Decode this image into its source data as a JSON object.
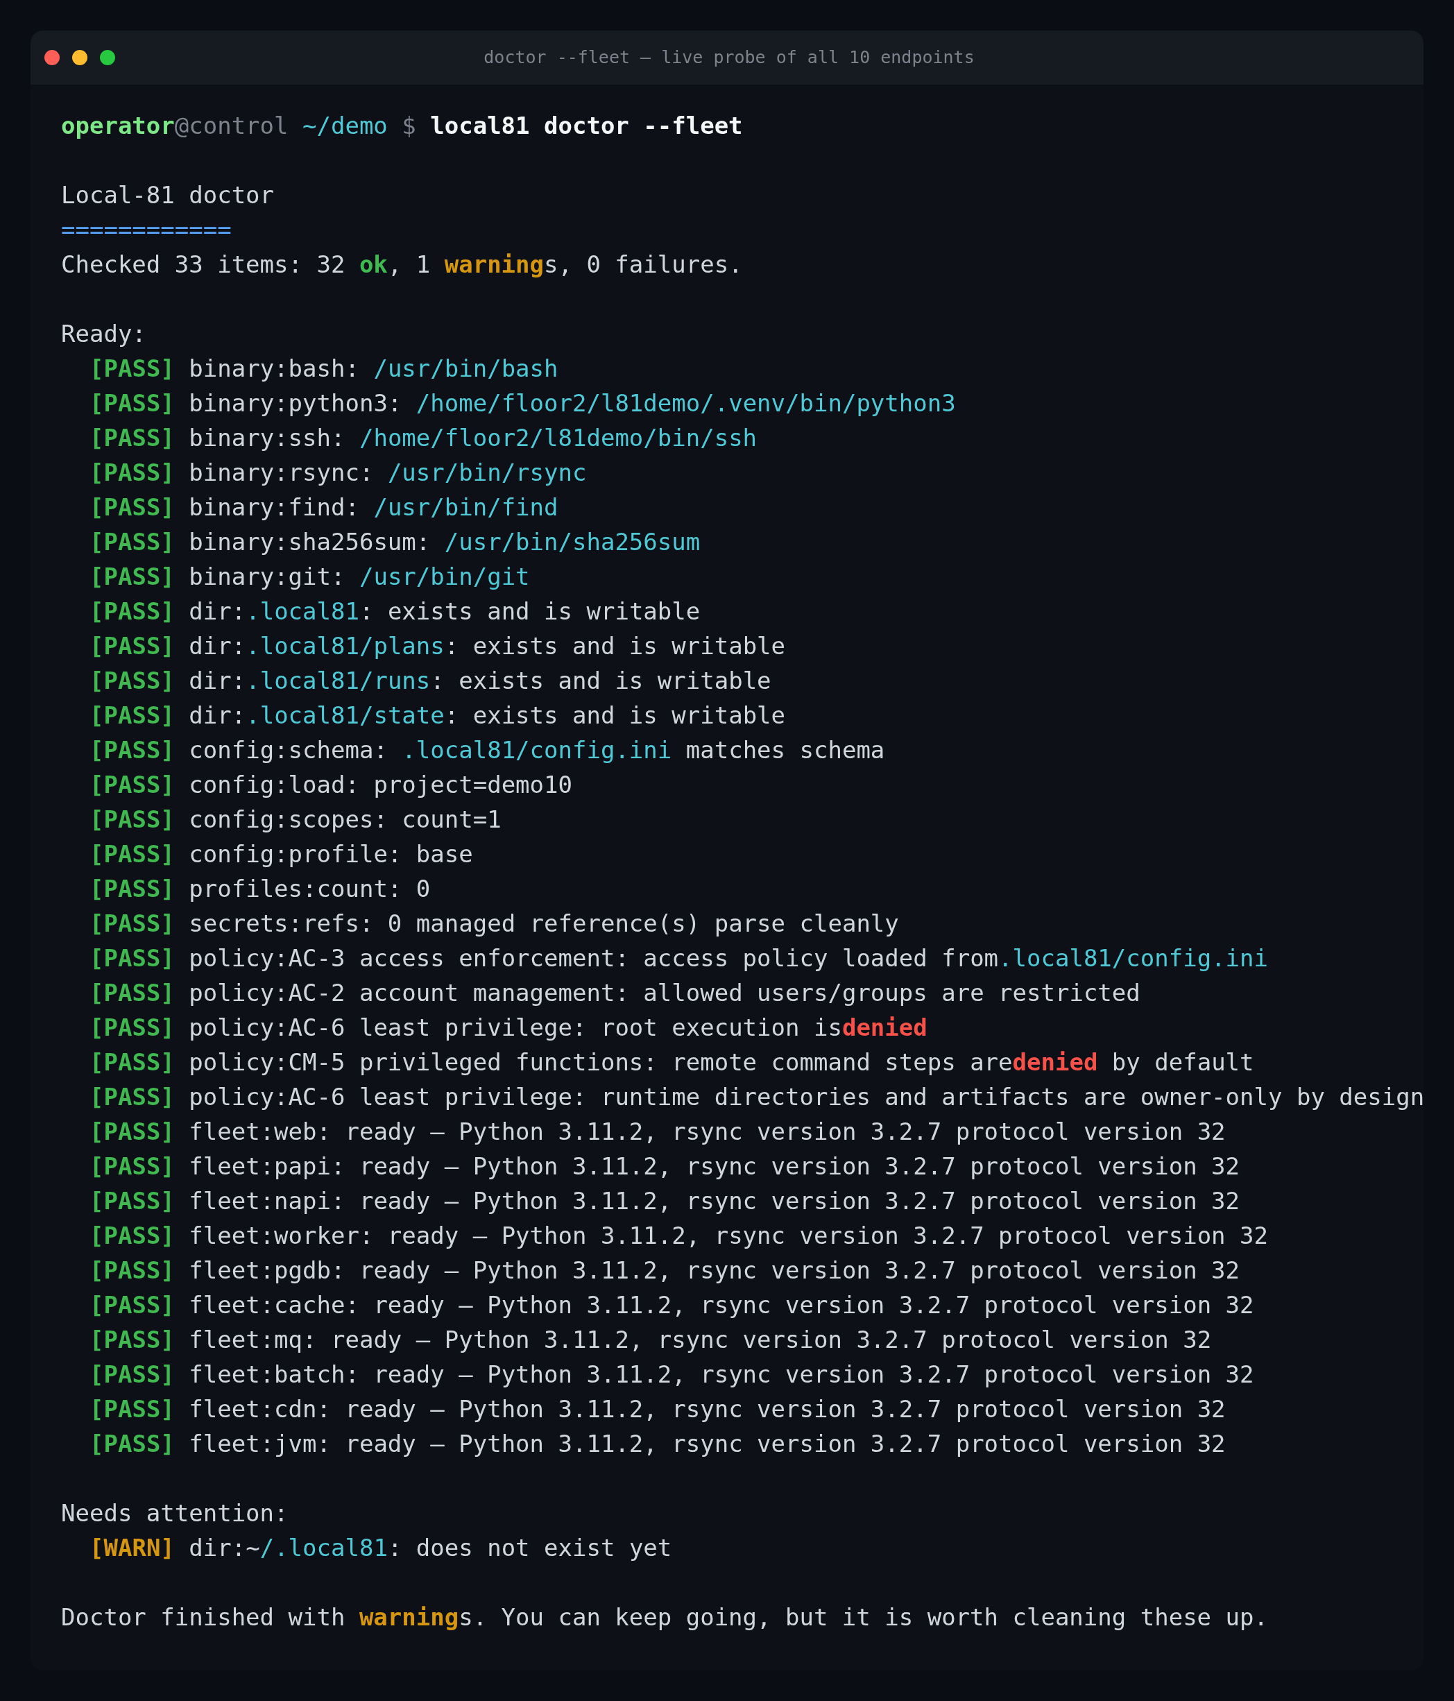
{
  "window": {
    "title": "doctor --fleet — live probe of all 10 endpoints"
  },
  "blocks": [
    {
      "lines": [
        {
          "kind": "prompt",
          "segments": [
            {
              "t": "operator",
              "kind": "user"
            },
            {
              "t": "@control ",
              "kind": "dim"
            },
            {
              "t": "~/demo ",
              "kind": "cwd"
            },
            {
              "t": "$ ",
              "kind": "dim"
            },
            {
              "t": "local81 doctor --fleet",
              "kind": "cmd"
            }
          ]
        }
      ]
    },
    {
      "lines": [
        {
          "kind": "heading",
          "segments": [
            {
              "t": "Local-81 doctor"
            }
          ]
        },
        {
          "kind": "rule",
          "segments": [
            {
              "t": "============",
              "kind": "rule"
            }
          ]
        },
        {
          "kind": "summary",
          "segments": [
            {
              "t": "Checked 33 items: 32 "
            },
            {
              "t": "ok",
              "kind": "ok"
            },
            {
              "t": ", 1 "
            },
            {
              "t": "warning",
              "kind": "warn"
            },
            {
              "t": "s, 0 failures."
            }
          ]
        }
      ]
    },
    {
      "lines": [
        {
          "kind": "label",
          "segments": [
            {
              "t": "Ready:"
            }
          ]
        },
        {
          "kind": "check",
          "segments": [
            {
              "t": "[PASS]",
              "kind": "ok"
            },
            {
              "t": " binary:bash: "
            },
            {
              "t": "/usr/bin/bash",
              "kind": "path"
            }
          ]
        },
        {
          "kind": "check",
          "segments": [
            {
              "t": "[PASS]",
              "kind": "ok"
            },
            {
              "t": " binary:python3: "
            },
            {
              "t": "/home/floor2/l81demo/.venv/bin/python3",
              "kind": "path"
            }
          ]
        },
        {
          "kind": "check",
          "segments": [
            {
              "t": "[PASS]",
              "kind": "ok"
            },
            {
              "t": " binary:ssh: "
            },
            {
              "t": "/home/floor2/l81demo/bin/ssh",
              "kind": "path"
            }
          ]
        },
        {
          "kind": "check",
          "segments": [
            {
              "t": "[PASS]",
              "kind": "ok"
            },
            {
              "t": " binary:rsync: "
            },
            {
              "t": "/usr/bin/rsync",
              "kind": "path"
            }
          ]
        },
        {
          "kind": "check",
          "segments": [
            {
              "t": "[PASS]",
              "kind": "ok"
            },
            {
              "t": " binary:find: "
            },
            {
              "t": "/usr/bin/find",
              "kind": "path"
            }
          ]
        },
        {
          "kind": "check",
          "segments": [
            {
              "t": "[PASS]",
              "kind": "ok"
            },
            {
              "t": " binary:sha256sum: "
            },
            {
              "t": "/usr/bin/sha256sum",
              "kind": "path"
            }
          ]
        },
        {
          "kind": "check",
          "segments": [
            {
              "t": "[PASS]",
              "kind": "ok"
            },
            {
              "t": " binary:git: "
            },
            {
              "t": "/usr/bin/git",
              "kind": "path"
            }
          ]
        },
        {
          "kind": "check",
          "segments": [
            {
              "t": "[PASS]",
              "kind": "ok"
            },
            {
              "t": " dir:"
            },
            {
              "t": ".local81",
              "kind": "path"
            },
            {
              "t": ": exists and is writable"
            }
          ]
        },
        {
          "kind": "check",
          "segments": [
            {
              "t": "[PASS]",
              "kind": "ok"
            },
            {
              "t": " dir:"
            },
            {
              "t": ".local81/plans",
              "kind": "path"
            },
            {
              "t": ": exists and is writable"
            }
          ]
        },
        {
          "kind": "check",
          "segments": [
            {
              "t": "[PASS]",
              "kind": "ok"
            },
            {
              "t": " dir:"
            },
            {
              "t": ".local81/runs",
              "kind": "path"
            },
            {
              "t": ": exists and is writable"
            }
          ]
        },
        {
          "kind": "check",
          "segments": [
            {
              "t": "[PASS]",
              "kind": "ok"
            },
            {
              "t": " dir:"
            },
            {
              "t": ".local81/state",
              "kind": "path"
            },
            {
              "t": ": exists and is writable"
            }
          ]
        },
        {
          "kind": "check",
          "segments": [
            {
              "t": "[PASS]",
              "kind": "ok"
            },
            {
              "t": " config:schema: "
            },
            {
              "t": ".local81/config.ini",
              "kind": "path"
            },
            {
              "t": " matches schema"
            }
          ]
        },
        {
          "kind": "check",
          "segments": [
            {
              "t": "[PASS]",
              "kind": "ok"
            },
            {
              "t": " config:load: project=demo10"
            }
          ]
        },
        {
          "kind": "check",
          "segments": [
            {
              "t": "[PASS]",
              "kind": "ok"
            },
            {
              "t": " config:scopes: count=1"
            }
          ]
        },
        {
          "kind": "check",
          "segments": [
            {
              "t": "[PASS]",
              "kind": "ok"
            },
            {
              "t": " config:profile: base"
            }
          ]
        },
        {
          "kind": "check",
          "segments": [
            {
              "t": "[PASS]",
              "kind": "ok"
            },
            {
              "t": " profiles:count: 0"
            }
          ]
        },
        {
          "kind": "check",
          "segments": [
            {
              "t": "[PASS]",
              "kind": "ok"
            },
            {
              "t": " secrets:refs: 0 managed reference(s) parse cleanly"
            }
          ]
        },
        {
          "kind": "check",
          "segments": [
            {
              "t": "[PASS]",
              "kind": "ok"
            },
            {
              "t": " policy:AC-3 access enforcement: access policy loaded from"
            },
            {
              "t": ".local81/config.ini",
              "kind": "path"
            }
          ]
        },
        {
          "kind": "check",
          "segments": [
            {
              "t": "[PASS]",
              "kind": "ok"
            },
            {
              "t": " policy:AC-2 account management: allowed users/groups are restricted"
            }
          ]
        },
        {
          "kind": "check",
          "segments": [
            {
              "t": "[PASS]",
              "kind": "ok"
            },
            {
              "t": " policy:AC-6 least privilege: root execution is"
            },
            {
              "t": "denied",
              "kind": "deny"
            }
          ]
        },
        {
          "kind": "check",
          "segments": [
            {
              "t": "[PASS]",
              "kind": "ok"
            },
            {
              "t": " policy:CM-5 privileged functions: remote command steps are"
            },
            {
              "t": "denied",
              "kind": "deny"
            },
            {
              "t": " by default"
            }
          ]
        },
        {
          "kind": "check",
          "segments": [
            {
              "t": "[PASS]",
              "kind": "ok"
            },
            {
              "t": " policy:AC-6 least privilege: runtime directories and artifacts are owner-only by design"
            }
          ]
        },
        {
          "kind": "check",
          "segments": [
            {
              "t": "[PASS]",
              "kind": "ok"
            },
            {
              "t": " fleet:web: ready — Python 3.11.2, rsync version 3.2.7 protocol version 32"
            }
          ]
        },
        {
          "kind": "check",
          "segments": [
            {
              "t": "[PASS]",
              "kind": "ok"
            },
            {
              "t": " fleet:papi: ready — Python 3.11.2, rsync version 3.2.7 protocol version 32"
            }
          ]
        },
        {
          "kind": "check",
          "segments": [
            {
              "t": "[PASS]",
              "kind": "ok"
            },
            {
              "t": " fleet:napi: ready — Python 3.11.2, rsync version 3.2.7 protocol version 32"
            }
          ]
        },
        {
          "kind": "check",
          "segments": [
            {
              "t": "[PASS]",
              "kind": "ok"
            },
            {
              "t": " fleet:worker: ready — Python 3.11.2, rsync version 3.2.7 protocol version 32"
            }
          ]
        },
        {
          "kind": "check",
          "segments": [
            {
              "t": "[PASS]",
              "kind": "ok"
            },
            {
              "t": " fleet:pgdb: ready — Python 3.11.2, rsync version 3.2.7 protocol version 32"
            }
          ]
        },
        {
          "kind": "check",
          "segments": [
            {
              "t": "[PASS]",
              "kind": "ok"
            },
            {
              "t": " fleet:cache: ready — Python 3.11.2, rsync version 3.2.7 protocol version 32"
            }
          ]
        },
        {
          "kind": "check",
          "segments": [
            {
              "t": "[PASS]",
              "kind": "ok"
            },
            {
              "t": " fleet:mq: ready — Python 3.11.2, rsync version 3.2.7 protocol version 32"
            }
          ]
        },
        {
          "kind": "check",
          "segments": [
            {
              "t": "[PASS]",
              "kind": "ok"
            },
            {
              "t": " fleet:batch: ready — Python 3.11.2, rsync version 3.2.7 protocol version 32"
            }
          ]
        },
        {
          "kind": "check",
          "segments": [
            {
              "t": "[PASS]",
              "kind": "ok"
            },
            {
              "t": " fleet:cdn: ready — Python 3.11.2, rsync version 3.2.7 protocol version 32"
            }
          ]
        },
        {
          "kind": "check",
          "segments": [
            {
              "t": "[PASS]",
              "kind": "ok"
            },
            {
              "t": " fleet:jvm: ready — Python 3.11.2, rsync version 3.2.7 protocol version 32"
            }
          ]
        }
      ]
    },
    {
      "lines": [
        {
          "kind": "label",
          "segments": [
            {
              "t": "Needs attention:"
            }
          ]
        },
        {
          "kind": "check",
          "segments": [
            {
              "t": "[WARN]",
              "kind": "warn"
            },
            {
              "t": " dir:~"
            },
            {
              "t": "/.local81",
              "kind": "path"
            },
            {
              "t": ": does not exist yet"
            }
          ]
        }
      ]
    },
    {
      "lines": [
        {
          "kind": "message",
          "segments": [
            {
              "t": "Doctor finished with "
            },
            {
              "t": "warning",
              "kind": "warn"
            },
            {
              "t": "s. You can keep going, but it is worth cleaning these up."
            }
          ]
        }
      ]
    }
  ]
}
